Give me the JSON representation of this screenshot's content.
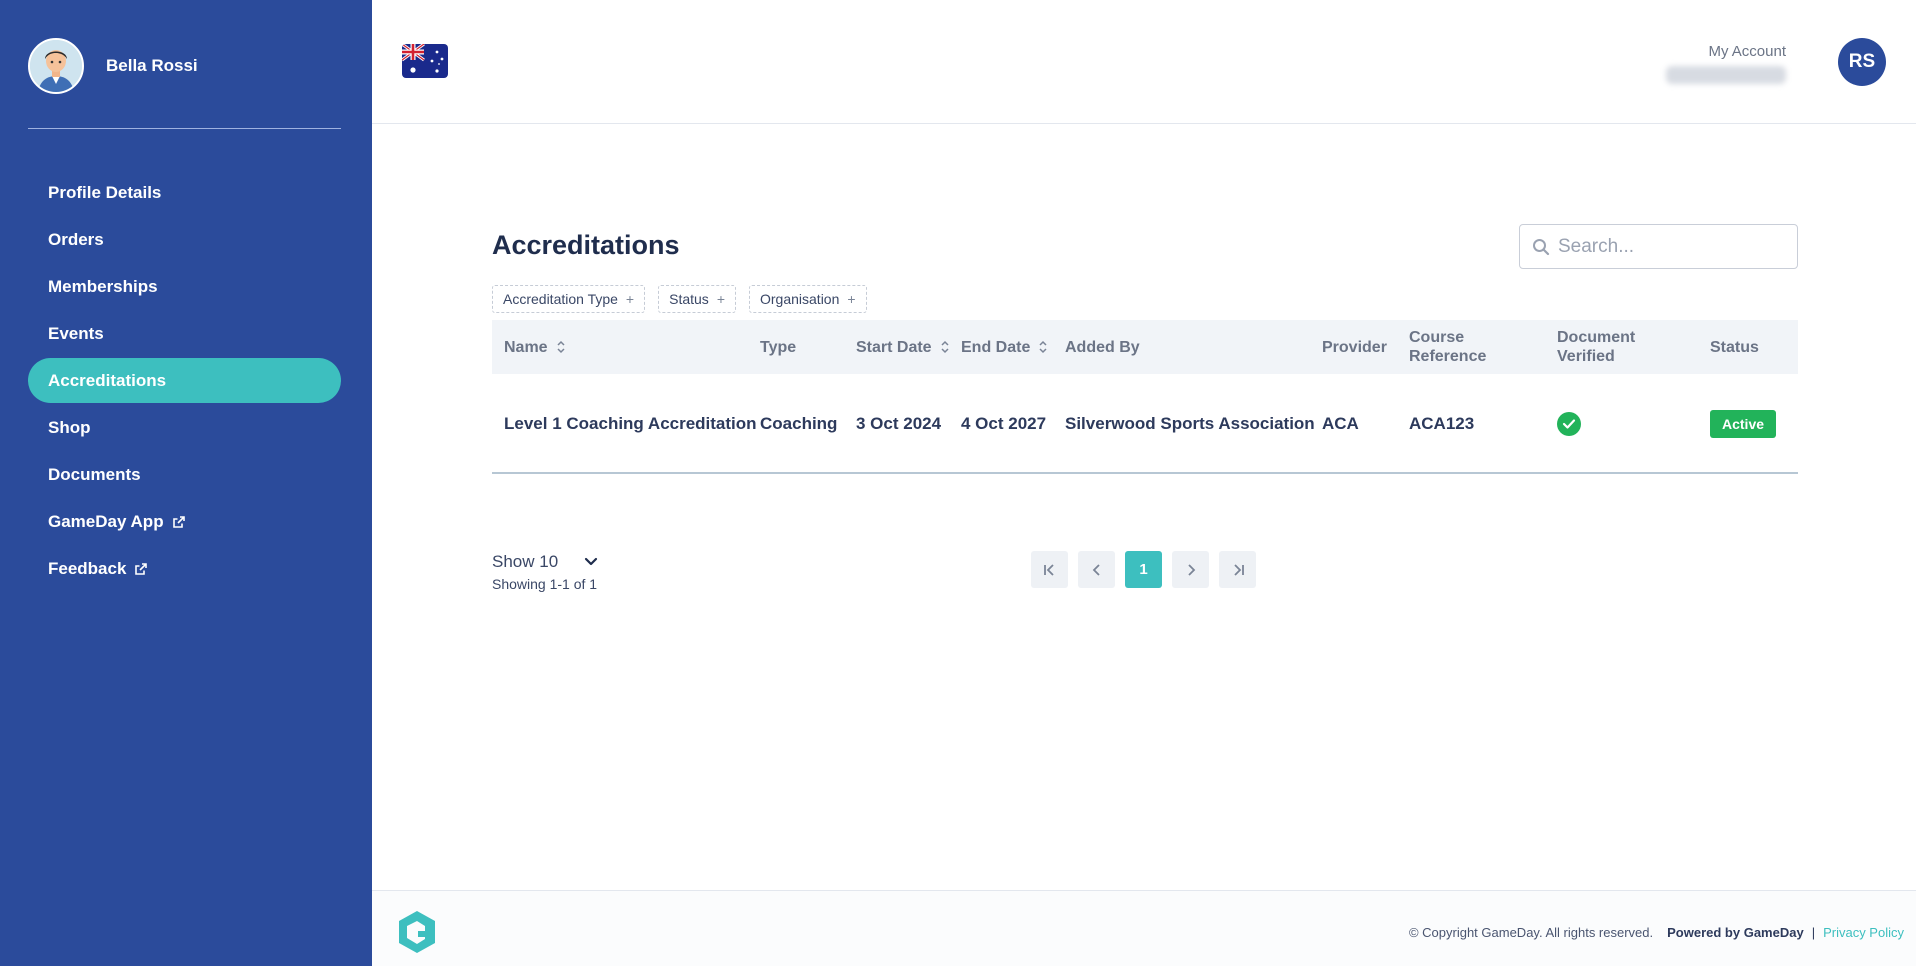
{
  "user": {
    "name": "Bella Rossi"
  },
  "sidebar": {
    "items": [
      {
        "label": "Profile Details",
        "active": false,
        "external": false
      },
      {
        "label": "Orders",
        "active": false,
        "external": false
      },
      {
        "label": "Memberships",
        "active": false,
        "external": false
      },
      {
        "label": "Events",
        "active": false,
        "external": false
      },
      {
        "label": "Accreditations",
        "active": true,
        "external": false
      },
      {
        "label": "Shop",
        "active": false,
        "external": false
      },
      {
        "label": "Documents",
        "active": false,
        "external": false
      },
      {
        "label": "GameDay App",
        "active": false,
        "external": true
      },
      {
        "label": "Feedback",
        "active": false,
        "external": true
      }
    ]
  },
  "header": {
    "flag_icon": "australia-flag-icon",
    "account_label": "My Account",
    "account_initials": "RS"
  },
  "main": {
    "title": "Accreditations",
    "search_placeholder": "Search...",
    "filters": [
      "Accreditation Type",
      "Status",
      "Organisation"
    ],
    "columns": [
      {
        "line1": "Name",
        "line2": "",
        "sortable": true
      },
      {
        "line1": "Type",
        "line2": "",
        "sortable": false
      },
      {
        "line1": "Start Date",
        "line2": "",
        "sortable": true
      },
      {
        "line1": "End Date",
        "line2": "",
        "sortable": true
      },
      {
        "line1": "Added By",
        "line2": "",
        "sortable": false
      },
      {
        "line1": "Provider",
        "line2": "",
        "sortable": false
      },
      {
        "line1": "Course",
        "line2": "Reference",
        "sortable": false
      },
      {
        "line1": "Document",
        "line2": "Verified",
        "sortable": false
      },
      {
        "line1": "Status",
        "line2": "",
        "sortable": false
      }
    ],
    "rows": [
      {
        "name": "Level 1 Coaching Accreditation",
        "type": "Coaching",
        "start_date": "3 Oct 2024",
        "end_date": "4 Oct 2027",
        "added_by": "Silverwood Sports Association",
        "provider": "ACA",
        "course_reference": "ACA123",
        "document_verified": true,
        "status": "Active"
      }
    ],
    "pagination": {
      "show_label": "Show 10",
      "showing_text": "Showing 1-1 of 1",
      "current_page": "1"
    }
  },
  "footer": {
    "copyright": "© Copyright GameDay. All rights reserved.",
    "powered_by": "Powered by GameDay",
    "separator": "|",
    "privacy": "Privacy Policy"
  },
  "colors": {
    "sidebar_bg": "#2b4b9b",
    "accent": "#3dbfbf",
    "success": "#22b35a"
  }
}
